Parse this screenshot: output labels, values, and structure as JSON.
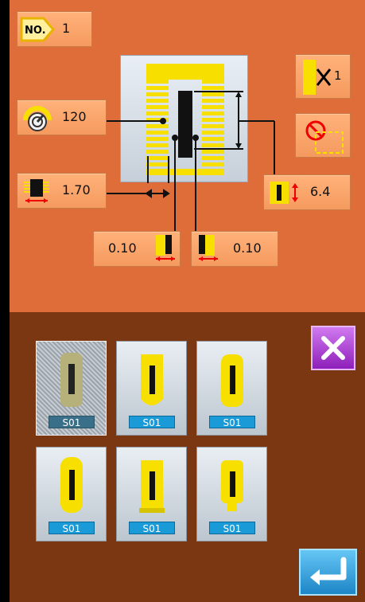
{
  "header": {
    "no_label": "NO.",
    "no_value": "1"
  },
  "params": {
    "speed": "120",
    "overlap": "1.70",
    "right_spacing": "6.4",
    "left_offset": "0.10",
    "right_offset": "0.10",
    "count": "1"
  },
  "thumbnails": [
    {
      "label": "S01"
    },
    {
      "label": "S01"
    },
    {
      "label": "S01"
    },
    {
      "label": "S01"
    },
    {
      "label": "S01"
    },
    {
      "label": "S01"
    }
  ],
  "colors": {
    "top_panel": "#df6d3a",
    "bottom_panel": "#7a3712",
    "button": "#f59a5f",
    "accent_yellow": "#f7e000",
    "selected_label": "#3a6f8a",
    "label_blue": "#1a9ad6"
  },
  "icons": {
    "pattern_number": "no-tag-icon",
    "speed": "speed-dial-icon",
    "overlap": "overlap-icon",
    "spacing": "spacing-icon",
    "count": "stitch-count-icon",
    "no_sew": "no-sew-icon",
    "close": "close-icon",
    "enter": "enter-icon"
  }
}
